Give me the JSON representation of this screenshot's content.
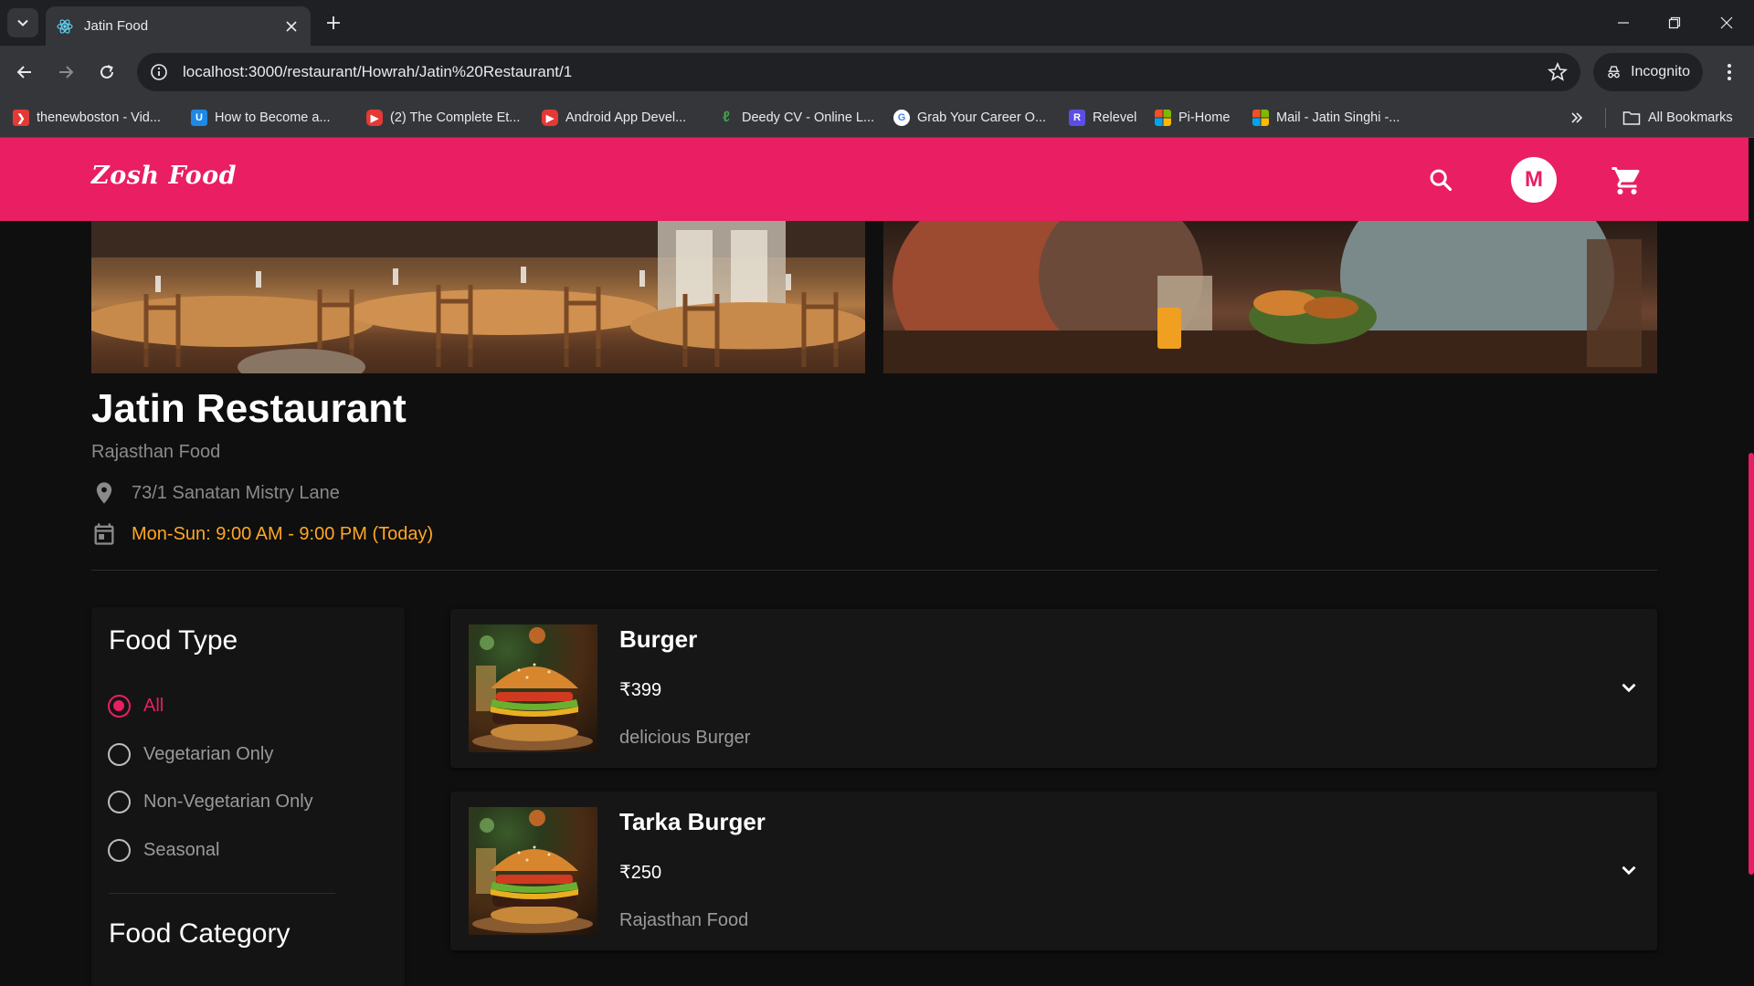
{
  "browser": {
    "tab_title": "Jatin Food",
    "url": "localhost:3000/restaurant/Howrah/Jatin%20Restaurant/1",
    "incognito_label": "Incognito",
    "bookmarks": [
      {
        "label": "thenewboston - Vid...",
        "icon": "thenewboston-icon",
        "color": "#e53935"
      },
      {
        "label": "How to Become a...",
        "icon": "shield-icon",
        "color": "#1e88e5"
      },
      {
        "label": "(2) The Complete Et...",
        "icon": "youtube-icon",
        "color": "#e53935"
      },
      {
        "label": "Android App Devel...",
        "icon": "youtube-icon",
        "color": "#e53935"
      },
      {
        "label": "Deedy CV - Online L...",
        "icon": "leaf-icon",
        "color": "#43a047"
      },
      {
        "label": "Grab Your Career O...",
        "icon": "google-icon",
        "color": "#ffffff"
      },
      {
        "label": "Relevel",
        "icon": "relevel-icon",
        "color": "#5c4ee5"
      },
      {
        "label": "Pi-Home",
        "icon": "microsoft-icon",
        "color": "#f25022"
      },
      {
        "label": "Mail - Jatin Singhi -...",
        "icon": "microsoft-icon",
        "color": "#f25022"
      }
    ],
    "all_bookmarks_label": "All Bookmarks"
  },
  "navbar": {
    "logo": "Zosh Food",
    "avatar_letter": "M",
    "brand_color": "#e91e63"
  },
  "restaurant": {
    "name": "Jatin Restaurant",
    "cuisine": "Rajasthan Food",
    "address": "73/1 Sanatan Mistry Lane",
    "hours": "Mon-Sun: 9:00 AM - 9:00 PM (Today)",
    "hours_color": "#ffa726"
  },
  "filters": {
    "food_type_heading": "Food Type",
    "food_type_options": [
      {
        "label": "All",
        "selected": true
      },
      {
        "label": "Vegetarian Only",
        "selected": false
      },
      {
        "label": "Non-Vegetarian Only",
        "selected": false
      },
      {
        "label": "Seasonal",
        "selected": false
      }
    ],
    "food_category_heading": "Food Category"
  },
  "menu_items": [
    {
      "name": "Burger",
      "price": "₹399",
      "description": "delicious Burger"
    },
    {
      "name": "Tarka Burger",
      "price": "₹250",
      "description": "Rajasthan Food"
    }
  ]
}
